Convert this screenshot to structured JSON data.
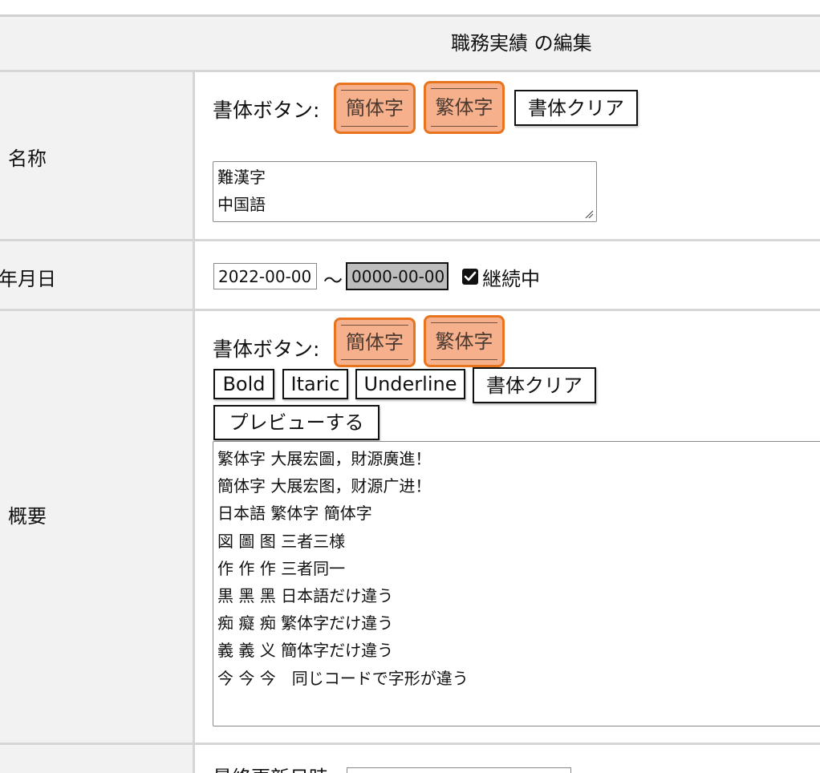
{
  "header": {
    "title": "職務実績 の編集"
  },
  "rows": {
    "name": {
      "label": "名称",
      "font_buttons_label": "書体ボタン:",
      "simplified_button": "簡体字",
      "traditional_button": "繁体字",
      "clear_button": "書体クリア",
      "textarea_lines": [
        "難漢字",
        "中国語"
      ]
    },
    "date": {
      "label": "年月日",
      "start_value": "2022-00-00",
      "tilde": "〜",
      "end_value": "0000-00-00",
      "ongoing_checked": true,
      "ongoing_label": "継続中"
    },
    "summary": {
      "label": "概要",
      "font_buttons_label": "書体ボタン:",
      "simplified_button": "簡体字",
      "traditional_button": "繁体字",
      "bold_button": "Bold",
      "italic_button": "Itaric",
      "underline_button": "Underline",
      "clear_button": "書体クリア",
      "preview_button": "プレビューする",
      "textarea_lines": [
        "繁体字 大展宏圖，財源廣進！",
        "簡体字 大展宏图，财源广进！",
        "日本語 繁体字 簡体字",
        "図 圖 图 三者三様",
        "作 作 作 三者同一",
        "黒 黑 黑 日本語だけ違う",
        "痴 癡 痴 繁体字だけ違う",
        "義 義 义 簡体字だけ違う",
        "今 今 今　同じコードで字形が違う"
      ]
    },
    "updated": {
      "label_partial": "最終更新日時"
    }
  },
  "colors": {
    "highlight_fill": "#f6b08b",
    "highlight_border": "#e8741e",
    "label_bg": "#f2f2f2",
    "rule": "#d6d6d6"
  }
}
